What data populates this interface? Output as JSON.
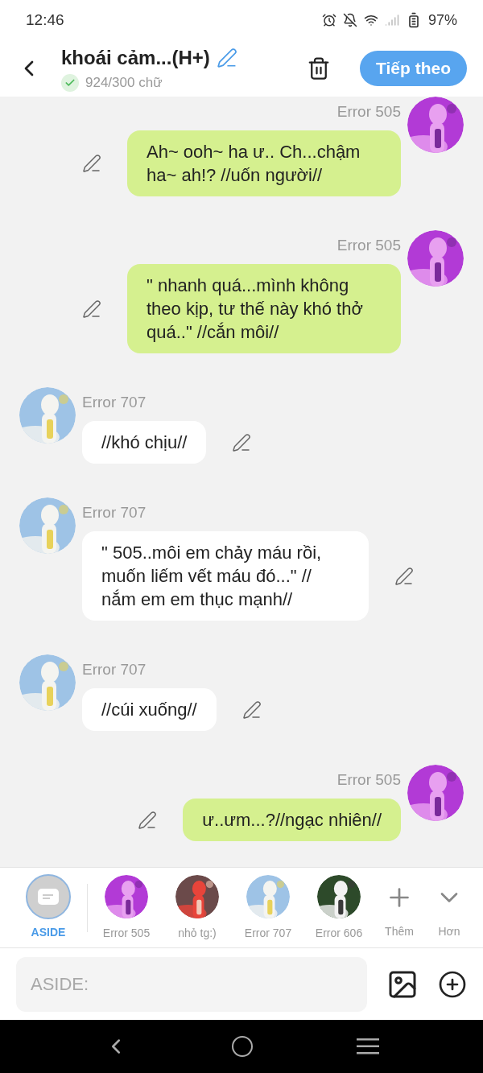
{
  "status_bar": {
    "time": "12:46",
    "battery": "97%"
  },
  "header": {
    "title": "khoái cảm...(H+)",
    "word_count": "924/300 chữ",
    "count_ok": true,
    "next_button": "Tiếp theo"
  },
  "messages": [
    {
      "kind": "right",
      "name": "Error 505",
      "text": "Ah~ ooh~ ha ư.. Ch...chậm ha~ ah!? //uốn người//"
    },
    {
      "kind": "right",
      "name": "Error 505",
      "text": "\" nhanh quá...mình không theo kịp, tư thế này khó thở quá..\" //cắn môi//"
    },
    {
      "kind": "left",
      "name": "Error 707",
      "text": "//khó chịu//"
    },
    {
      "kind": "left",
      "name": "Error 707",
      "text": "\" 505..môi em chảy máu rồi, muốn liếm vết máu đó...\" // nắm em em thục mạnh//"
    },
    {
      "kind": "left",
      "name": "Error 707",
      "text": "//cúi xuống//"
    },
    {
      "kind": "right",
      "name": "Error 505",
      "text": "ư..ưm...?//ngạc nhiên//"
    }
  ],
  "characters": [
    {
      "kind": "aside",
      "label": "ASIDE",
      "selected": true
    },
    {
      "kind": "avatar",
      "label": "Error 505",
      "selected": false
    },
    {
      "kind": "avatar",
      "label": "nhỏ tg:)",
      "selected": false
    },
    {
      "kind": "avatar",
      "label": "Error 707",
      "selected": false
    },
    {
      "kind": "avatar",
      "label": "Error 606",
      "selected": false
    },
    {
      "kind": "add",
      "label": "Thêm",
      "selected": false
    },
    {
      "kind": "more",
      "label": "Hơn",
      "selected": false
    }
  ],
  "input": {
    "placeholder": "ASIDE:"
  }
}
